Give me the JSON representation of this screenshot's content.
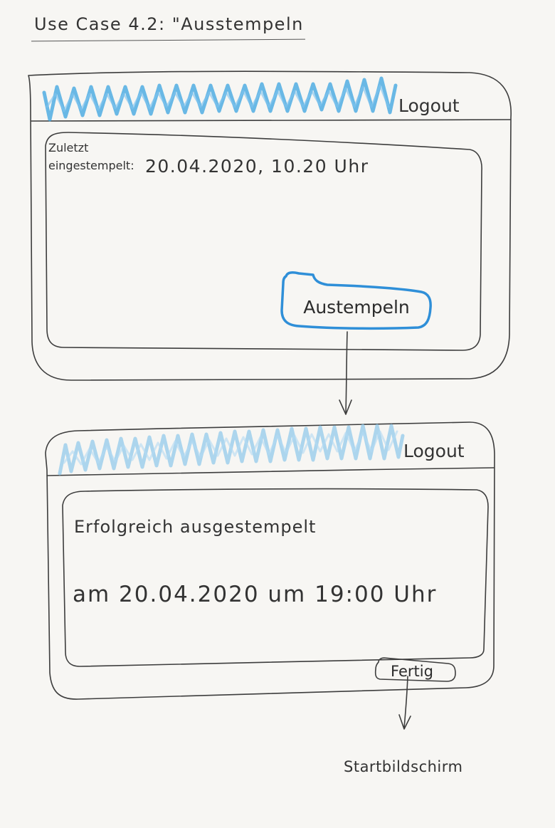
{
  "title": "Use Case 4.2: \"Ausstempeln",
  "screen1": {
    "logout_label": "Logout",
    "last_stamp_label_line1": "Zuletzt",
    "last_stamp_label_line2": "eingestempelt:",
    "last_stamp_value": "20.04.2020, 10.20 Uhr",
    "button_label": "Austempeln",
    "header_scribble_color": "#3aa3e0",
    "button_color": "#2f8fd8"
  },
  "screen2": {
    "logout_label": "Logout",
    "success_title": "Erfolgreich ausgestempelt",
    "success_detail": "am 20.04.2020 um 19:00 Uhr",
    "button_label": "Fertig",
    "header_scribble_color": "#8cc8ea"
  },
  "next_screen_label": "Startbildschirm"
}
